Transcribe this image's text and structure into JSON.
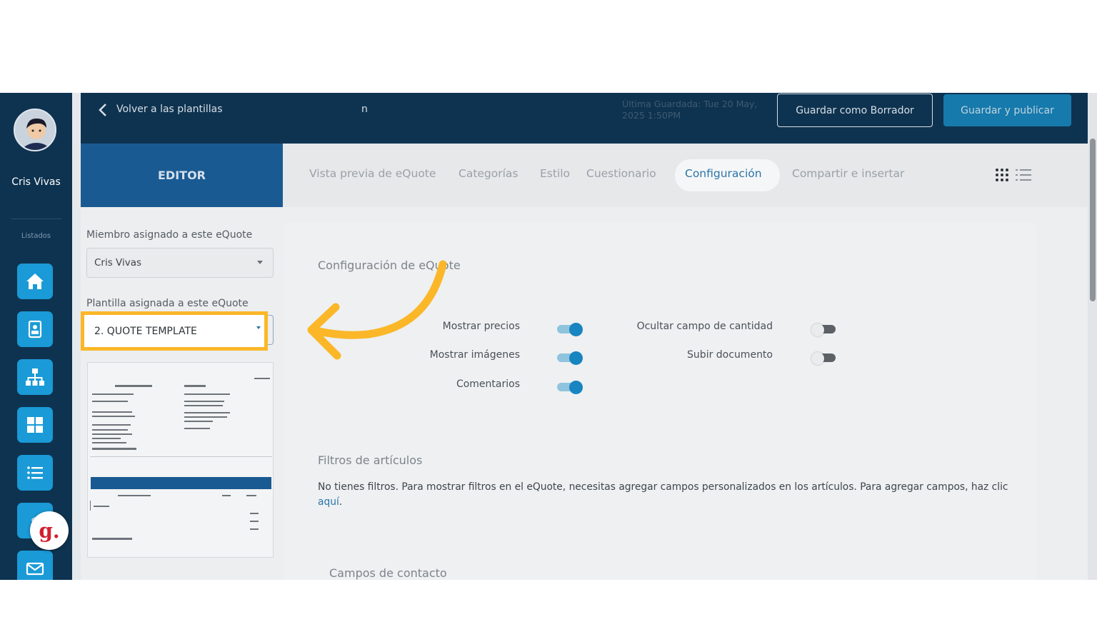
{
  "sidebar": {
    "user_name": "Cris Vivas",
    "section_label": "Listados",
    "items": [
      {
        "icon": "home-icon"
      },
      {
        "icon": "contact-card-icon"
      },
      {
        "icon": "org-chart-icon"
      },
      {
        "icon": "grid-icon"
      },
      {
        "icon": "list-icon"
      },
      {
        "icon": "dollar-icon"
      },
      {
        "icon": "mail-icon"
      }
    ],
    "badge_letter": "g."
  },
  "topbar": {
    "back_label": "Volver a las plantillas",
    "doc_title": "n",
    "saved_info": "Última Guardada: Tue 20 May, 2025 1:50PM",
    "draft_button": "Guardar como Borrador",
    "publish_button": "Guardar y publicar"
  },
  "tabs": {
    "editor": "EDITOR",
    "items": [
      "Vista previa de eQuote",
      "Categorías",
      "Estilo",
      "Cuestionario",
      "Configuración",
      "Compartir e insertar"
    ],
    "active": "Configuración"
  },
  "left_panel": {
    "member_label": "Miembro asignado a este eQuote",
    "member_value": "Cris Vivas",
    "template_label": "Plantilla asignada a este eQuote",
    "template_value": "2. QUOTE TEMPLATE"
  },
  "config": {
    "title": "Configuración de eQuote",
    "options_left": [
      {
        "label": "Mostrar precios",
        "on": true
      },
      {
        "label": "Mostrar imágenes",
        "on": true
      },
      {
        "label": "Comentarios",
        "on": true
      }
    ],
    "options_right": [
      {
        "label": "Ocultar campo de cantidad",
        "on": false
      },
      {
        "label": "Subir documento",
        "on": false
      }
    ],
    "filters_title": "Filtros de artículos",
    "filters_text": "No tienes filtros. Para mostrar filtros en el eQuote, necesitas agregar campos personalizados en los artículos. Para agregar campos, haz clic ",
    "filters_link": "aquí",
    "filters_end": ".",
    "contact_title": "Campos de contacto"
  },
  "colors": {
    "accent": "#fbb728",
    "nav_dark": "#0e3350",
    "primary": "#1a9ad6"
  }
}
